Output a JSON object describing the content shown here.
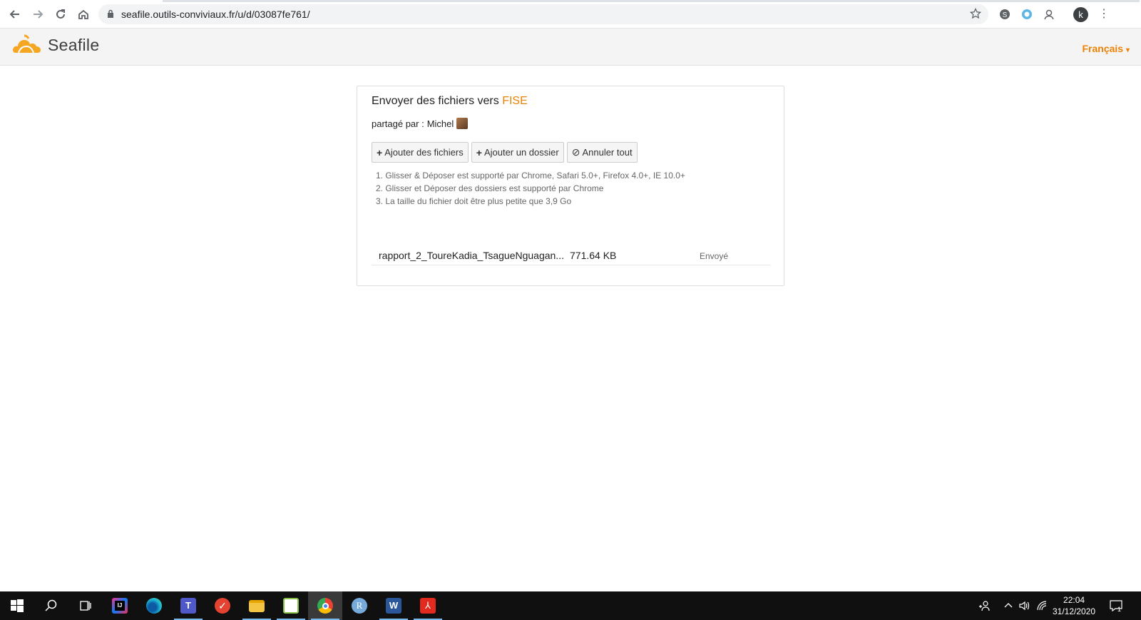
{
  "browser": {
    "url": "seafile.outils-conviviaux.fr/u/d/03087fe761/",
    "profile_initial": "k",
    "icons": [
      "back-icon",
      "forward-icon",
      "reload-icon",
      "home-icon",
      "lock-icon",
      "star-icon",
      "skype-icon",
      "extension-icon",
      "profile-icon",
      "menu-icon"
    ]
  },
  "header": {
    "logo_text": "Seafile",
    "language": "Français"
  },
  "upload": {
    "title_prefix": "Envoyer des fichiers vers",
    "title_target": "FISE",
    "shared_by_label": "partagé par :",
    "shared_by_user": "Michel",
    "buttons": {
      "add_files": "Ajouter des fichiers",
      "add_folder": "Ajouter un dossier",
      "cancel_all": "Annuler tout"
    },
    "tips": [
      "1. Glisser & Déposer est supporté par Chrome, Safari 5.0+, Firefox 4.0+, IE 10.0+",
      "2. Glisser et Déposer des dossiers est supporté par Chrome",
      "3. La taille du fichier doit être plus petite que 3,9 Go"
    ],
    "files": [
      {
        "name": "rapport_2_ToureKadia_TsagueNguagan...",
        "size": "771.64 KB",
        "status": "Envoyé"
      }
    ]
  },
  "taskbar": {
    "time": "22:04",
    "date": "31/12/2020",
    "notification_count": "1",
    "apps": [
      "windows-start",
      "search",
      "task-view",
      "intellij",
      "edge",
      "teams",
      "todoist",
      "file-explorer",
      "notepad-plus",
      "chrome",
      "r-studio",
      "word",
      "acrobat"
    ]
  },
  "colors": {
    "accent": "#eb8205",
    "taskbar": "#101010"
  }
}
